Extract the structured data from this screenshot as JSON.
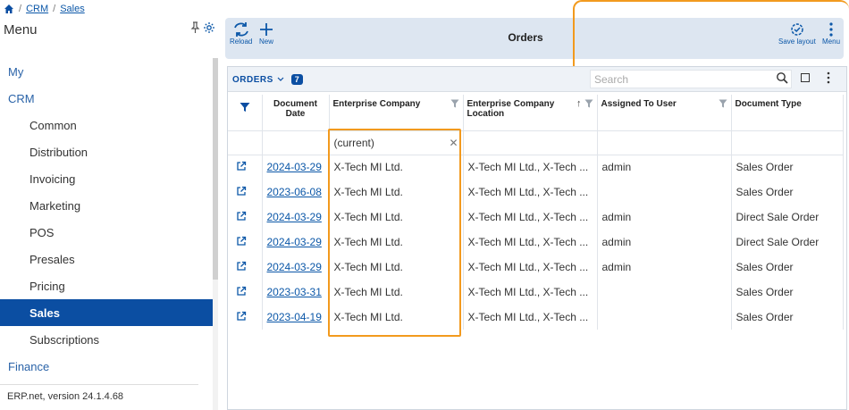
{
  "breadcrumb": {
    "items": [
      "CRM",
      "Sales"
    ],
    "separator": "/"
  },
  "sidebar": {
    "title": "Menu",
    "items": [
      {
        "label": "My",
        "level": 0,
        "active": false
      },
      {
        "label": "CRM",
        "level": 0,
        "active": false
      },
      {
        "label": "Common",
        "level": 1,
        "active": false
      },
      {
        "label": "Distribution",
        "level": 1,
        "active": false
      },
      {
        "label": "Invoicing",
        "level": 1,
        "active": false
      },
      {
        "label": "Marketing",
        "level": 1,
        "active": false
      },
      {
        "label": "POS",
        "level": 1,
        "active": false
      },
      {
        "label": "Presales",
        "level": 1,
        "active": false
      },
      {
        "label": "Pricing",
        "level": 1,
        "active": false
      },
      {
        "label": "Sales",
        "level": 1,
        "active": true
      },
      {
        "label": "Subscriptions",
        "level": 1,
        "active": false
      },
      {
        "label": "Finance",
        "level": 0,
        "active": false
      }
    ],
    "version": "ERP.net, version 24.1.4.68"
  },
  "toolbar": {
    "reload_label": "Reload",
    "new_label": "New",
    "title": "Orders",
    "save_layout_label": "Save layout",
    "menu_label": "Menu"
  },
  "grid": {
    "title": "ORDERS",
    "count": "7",
    "search_placeholder": "Search",
    "columns": [
      "Document Date",
      "Enterprise Company",
      "Enterprise Company Location",
      "Assigned To User",
      "Document Type"
    ],
    "filter_value": "(current)",
    "rows": [
      {
        "date": "2024-03-29",
        "company": "X-Tech MI Ltd.",
        "location": "X-Tech MI Ltd., X-Tech ...",
        "user": "admin",
        "type": "Sales Order"
      },
      {
        "date": "2023-06-08",
        "company": "X-Tech MI Ltd.",
        "location": "X-Tech MI Ltd., X-Tech ...",
        "user": "",
        "type": "Sales Order"
      },
      {
        "date": "2024-03-29",
        "company": "X-Tech MI Ltd.",
        "location": "X-Tech MI Ltd., X-Tech ...",
        "user": "admin",
        "type": "Direct Sale Order"
      },
      {
        "date": "2024-03-29",
        "company": "X-Tech MI Ltd.",
        "location": "X-Tech MI Ltd., X-Tech ...",
        "user": "admin",
        "type": "Direct Sale Order"
      },
      {
        "date": "2024-03-29",
        "company": "X-Tech MI Ltd.",
        "location": "X-Tech MI Ltd., X-Tech ...",
        "user": "admin",
        "type": "Sales Order"
      },
      {
        "date": "2023-03-31",
        "company": "X-Tech MI Ltd.",
        "location": "X-Tech MI Ltd., X-Tech ...",
        "user": "",
        "type": "Sales Order"
      },
      {
        "date": "2023-04-19",
        "company": "X-Tech MI Ltd.",
        "location": "X-Tech MI Ltd., X-Tech ...",
        "user": "",
        "type": "Sales Order"
      }
    ]
  },
  "colors": {
    "accent": "#0b4ea2",
    "highlight": "#f29a1e",
    "toolbar_bg": "#dde6f1"
  }
}
